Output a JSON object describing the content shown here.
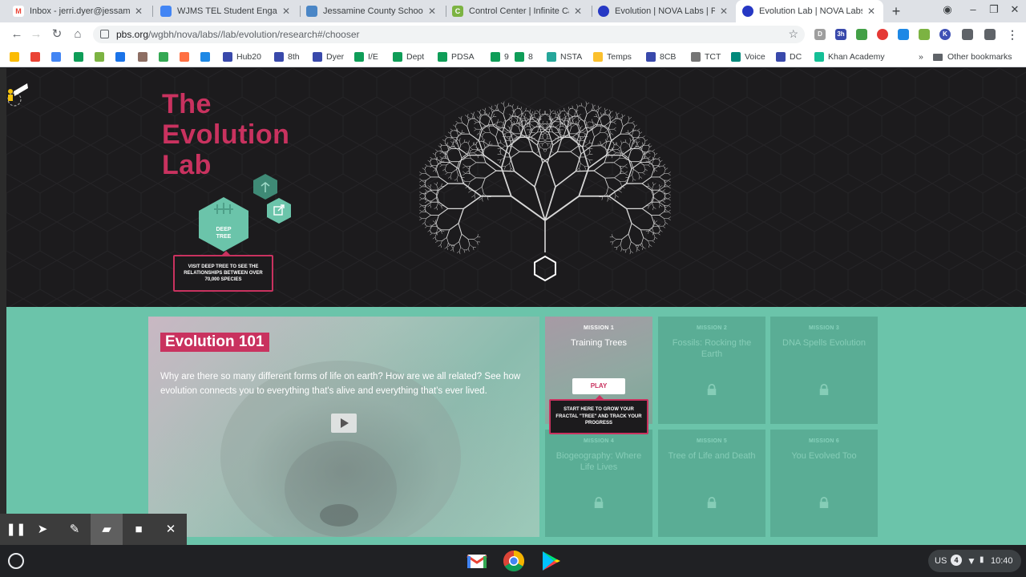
{
  "browser": {
    "tabs": [
      {
        "title": "Inbox - jerri.dyer@jessamine",
        "favicon": "gmail-icon",
        "color": "#ea4335",
        "letter": "M",
        "active": false
      },
      {
        "title": "WJMS TEL Student Engagem",
        "favicon": "google-docs-icon",
        "color": "#4285f4",
        "letter": "",
        "active": false
      },
      {
        "title": "Jessamine County Schools -",
        "favicon": "google-classroom-icon",
        "color": "#4a86c6",
        "letter": "",
        "active": false
      },
      {
        "title": "Control Center | Infinite Camp",
        "favicon": "infinite-campus-icon",
        "color": "#7cb342",
        "letter": "C",
        "active": false
      },
      {
        "title": "Evolution | NOVA Labs | PBS",
        "favicon": "pbs-icon",
        "color": "#2638c4",
        "letter": "",
        "active": false
      },
      {
        "title": "Evolution Lab | NOVA Labs | P",
        "favicon": "pbs-icon",
        "color": "#2638c4",
        "letter": "",
        "active": true
      }
    ],
    "url_host": "pbs.org",
    "url_path": "/wgbh/nova/labs//lab/evolution/research#/chooser",
    "bookmarks": [
      {
        "label": "",
        "icon": "drive-icon",
        "color": "#fbbc04"
      },
      {
        "label": "",
        "icon": "gmail-icon",
        "color": "#ea4335"
      },
      {
        "label": "",
        "icon": "calendar-icon",
        "color": "#4285f4"
      },
      {
        "label": "",
        "icon": "classroom-icon",
        "color": "#0f9d58"
      },
      {
        "label": "",
        "icon": "campus-icon",
        "color": "#7cb342"
      },
      {
        "label": "",
        "icon": "drive-icon",
        "color": "#1a73e8"
      },
      {
        "label": "",
        "icon": "book-icon",
        "color": "#8d6e63"
      },
      {
        "label": "",
        "icon": "maps-icon",
        "color": "#34a853"
      },
      {
        "label": "",
        "icon": "app-icon",
        "color": "#ff7043"
      },
      {
        "label": "",
        "icon": "chat-icon",
        "color": "#1e88e5"
      },
      {
        "label": "Hub20",
        "icon": "hub-icon",
        "color": "#3949ab"
      },
      {
        "label": "8th",
        "icon": "calendar-icon",
        "color": "#3949ab"
      },
      {
        "label": "Dyer",
        "icon": "calendar-icon",
        "color": "#3949ab"
      },
      {
        "label": "I/E",
        "icon": "sheets-icon",
        "color": "#0f9d58"
      },
      {
        "label": "Dept",
        "icon": "sheets-icon",
        "color": "#0f9d58"
      },
      {
        "label": "PDSA",
        "icon": "sheets-icon",
        "color": "#0f9d58"
      },
      {
        "label": "9",
        "icon": "sheets-icon",
        "color": "#0f9d58"
      },
      {
        "label": "8",
        "icon": "sheets-icon",
        "color": "#0f9d58"
      },
      {
        "label": "NSTA",
        "icon": "nsta-icon",
        "color": "#26a69a"
      },
      {
        "label": "Temps",
        "icon": "folder-icon",
        "color": "#fbc02d"
      },
      {
        "label": "8CB",
        "icon": "calendar-icon",
        "color": "#3949ab"
      },
      {
        "label": "TCT",
        "icon": "tct-icon",
        "color": "#757575"
      },
      {
        "label": "Voice",
        "icon": "voice-icon",
        "color": "#00897b"
      },
      {
        "label": "DC",
        "icon": "calendar-icon",
        "color": "#3949ab"
      },
      {
        "label": "Khan Academy",
        "icon": "khan-icon",
        "color": "#14bf96"
      }
    ],
    "more_bookmarks": "»",
    "other_bookmarks": "Other bookmarks"
  },
  "page": {
    "title_lines": [
      "The",
      "Evolution",
      "Lab"
    ],
    "deep_tree_label_1": "DEEP",
    "deep_tree_label_2": "TREE",
    "deep_tree_tooltip": "VISIT DEEP TREE TO SEE THE RELATIONSHIPS BETWEEN OVER 70,000 SPECIES",
    "video": {
      "heading": "Evolution 101",
      "description": "Why are there so many different forms of life on earth? How are we all related? See how evolution connects you to everything that's alive and everything that's ever lived."
    },
    "missions": [
      {
        "number": "MISSION 1",
        "name": "Training Trees",
        "locked": false
      },
      {
        "number": "MISSION 2",
        "name": "Fossils: Rocking the Earth",
        "locked": true
      },
      {
        "number": "MISSION 3",
        "name": "DNA Spells Evolution",
        "locked": true
      },
      {
        "number": "MISSION 4",
        "name": "Biogeography: Where Life Lives",
        "locked": true
      },
      {
        "number": "MISSION 5",
        "name": "Tree of Life and Death",
        "locked": true
      },
      {
        "number": "MISSION 6",
        "name": "You Evolved Too",
        "locked": true
      }
    ],
    "play_label": "PLAY",
    "mission_tooltip": "START HERE TO GROW YOUR FRACTAL \"TREE\" AND TRACK YOUR PROGRESS",
    "colors": {
      "accent": "#c9325f",
      "teal": "#6bc4aa",
      "dark": "#1c1b1d"
    }
  },
  "shelf": {
    "locale": "US",
    "notification_count": "4",
    "time": "10:40",
    "pinned_apps": [
      "gmail-icon",
      "chrome-icon",
      "play-store-icon"
    ]
  }
}
